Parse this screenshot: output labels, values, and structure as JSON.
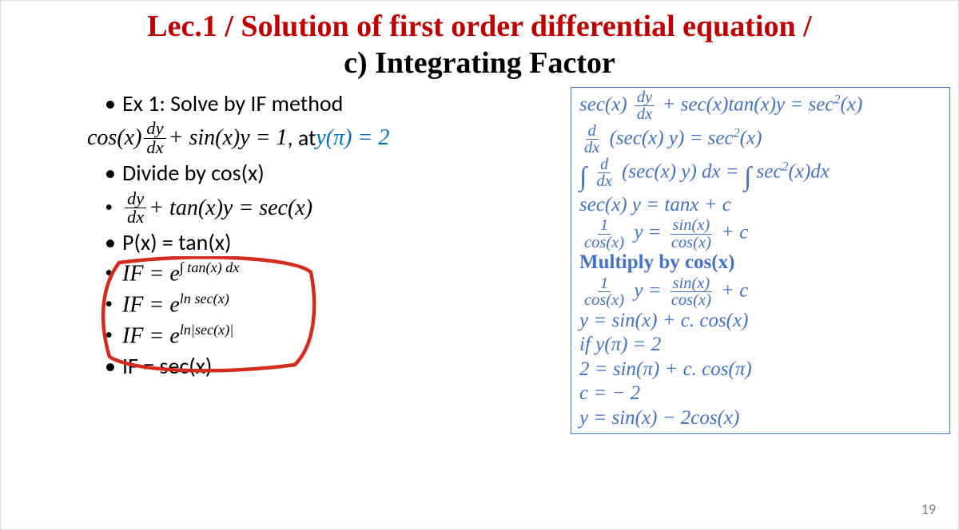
{
  "title": {
    "line1": "Lec.1 / Solution of first order differential equation /",
    "line2": "c) Integrating Factor"
  },
  "left": {
    "b0": "Ex 1: Solve by IF method",
    "eq1_cos": "cos(x)",
    "eq1_dy": "dy",
    "eq1_dx": "dx",
    "eq1_rest": "+ sin(x)y = 1",
    "eq1_at": ", at ",
    "eq1_cond": "y(π) = 2",
    "b1": "Divide by cos(x)",
    "eq2_dy": "dy",
    "eq2_dx": "dx",
    "eq2_rest": "+ tan(x)y = sec(x)",
    "b3": "P(x) = tan(x)",
    "b4_pre": "IF = e",
    "b4_sup": "∫ tan(x) dx",
    "b5_pre": "IF = e",
    "b5_sup": "ln sec(x)",
    "b6_pre": "IF = e",
    "b6_sup": "ln|sec(x)|",
    "b7": "IF = sec(x)"
  },
  "right": {
    "r1_a": "sec(x)",
    "r1_dy": "dy",
    "r1_dx": "dx",
    "r1_b": "+ sec(x)tan(x)y = sec",
    "r1_c": "(x)",
    "r2_a": "d",
    "r2_b": "dx",
    "r2_c": "(sec(x) y) = sec",
    "r2_d": "(x)",
    "r3_a": "d",
    "r3_b": "dx",
    "r3_c": "(sec(x) y) dx = ",
    "r3_d": "sec",
    "r3_e": "(x)dx",
    "r4": "sec(x) y = tanx + c",
    "r5_a": "1",
    "r5_b": "cos(x)",
    "r5_c": "y = ",
    "r5_d": "sin(x)",
    "r5_e": "cos(x)",
    "r5_f": "+ c",
    "r6": "Multiply by cos(x)",
    "r7_a": "1",
    "r7_b": "cos(x)",
    "r7_c": "y = ",
    "r7_d": "sin(x)",
    "r7_e": "cos(x)",
    "r7_f": "+ c",
    "r8": "y = sin(x) + c. cos(x)",
    "r9": " if  y(π) = 2",
    "r10": "2 = sin(π) + c. cos(π)",
    "r11": "c = − 2",
    "r12": "y = sin(x) − 2cos(x)"
  },
  "slidenum": "19"
}
